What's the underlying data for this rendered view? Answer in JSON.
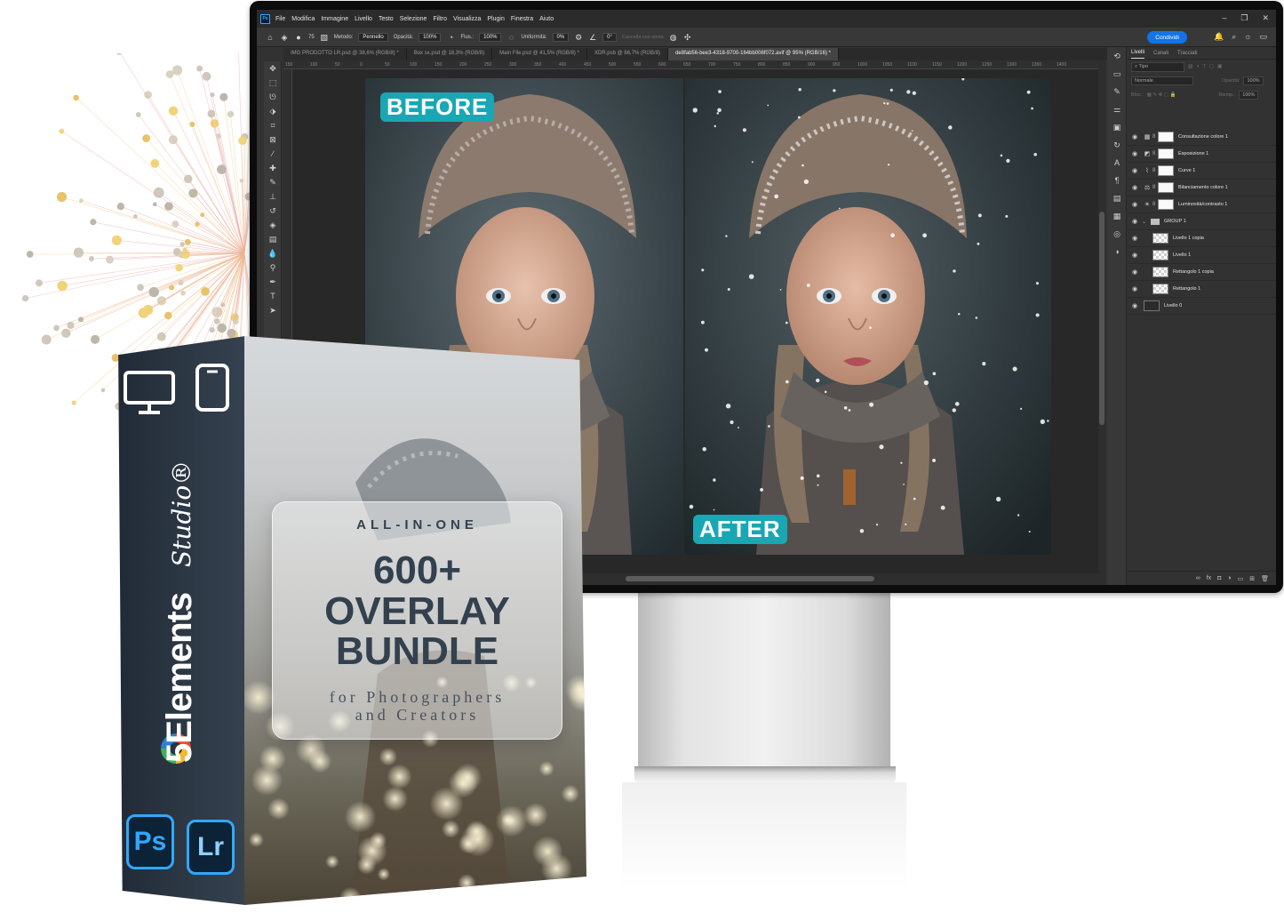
{
  "photoshop": {
    "app_icon": "Ps",
    "menu": [
      "File",
      "Modifica",
      "Immagine",
      "Livello",
      "Testo",
      "Selezione",
      "Filtro",
      "Visualizza",
      "Plugin",
      "Finestra",
      "Aiuto"
    ],
    "options": {
      "brush_size": "75",
      "mode_label": "Metodo:",
      "mode_value": "Pennello",
      "opacity_label": "Opacità:",
      "opacity_value": "100%",
      "flow_label": "Flus.:",
      "flow_value": "100%",
      "smoothing_label": "Uniformità:",
      "smoothing_value": "0%",
      "angle_value": "0°",
      "erase_history": "Cancella con storia",
      "share_button": "Condividi"
    },
    "tabs": [
      {
        "label": "IMG PRODOTTO LR.psd @ 38,6% (RGB/8) *",
        "active": false
      },
      {
        "label": "Box sx.psd @ 18,3% (RGB/8)",
        "active": false
      },
      {
        "label": "Main File.psd @ 41,5% (RGB/8) *",
        "active": false
      },
      {
        "label": "XDR.psb @ 66,7% (RGB/8)",
        "active": false
      },
      {
        "label": "de8fab56-bee3-4318-9700-164bb008f072.avif @ 95% (RGB/16) *",
        "active": true
      }
    ],
    "ruler_ticks": [
      "150",
      "100",
      "50",
      "0",
      "50",
      "100",
      "150",
      "200",
      "250",
      "300",
      "350",
      "400",
      "450",
      "500",
      "550",
      "600",
      "650",
      "700",
      "750",
      "800",
      "850",
      "900",
      "950",
      "1000",
      "1050",
      "1100",
      "1150",
      "1200",
      "1250",
      "1300",
      "1350",
      "1400"
    ],
    "canvas": {
      "before_label": "BEFORE",
      "after_label": "AFTER"
    },
    "panel": {
      "tabs": [
        "Livelli",
        "Canali",
        "Tracciati"
      ],
      "filter_placeholder": "Tipo",
      "blend_mode": "Normale",
      "opacity_label": "Opacità:",
      "opacity_value": "100%",
      "lock_label": "Bloc.:",
      "fill_label": "Riemp.:",
      "fill_value": "100%",
      "layers": [
        {
          "name": "Consultazione colore 1",
          "kind": "adjustment",
          "icon": "grid-adjust-icon"
        },
        {
          "name": "Esposizione 1",
          "kind": "adjustment",
          "icon": "exposure-icon"
        },
        {
          "name": "Curve 1",
          "kind": "adjustment",
          "icon": "curves-icon"
        },
        {
          "name": "Bilanciamento colore 1",
          "kind": "adjustment",
          "icon": "color-balance-icon"
        },
        {
          "name": "Luminosità/contrasto 1",
          "kind": "adjustment",
          "icon": "brightness-icon"
        },
        {
          "name": "GROUP 1",
          "kind": "group",
          "icon": "folder-icon"
        },
        {
          "name": "Livello 1 copia",
          "kind": "pixel",
          "icon": "transparent-thumb"
        },
        {
          "name": "Livello 1",
          "kind": "pixel",
          "icon": "transparent-thumb"
        },
        {
          "name": "Rettangolo 1 copia",
          "kind": "shape",
          "icon": "transparent-thumb"
        },
        {
          "name": "Rettangolo 1",
          "kind": "shape",
          "icon": "transparent-thumb"
        },
        {
          "name": "Livello 0",
          "kind": "pixel-photo",
          "icon": "photo-thumb"
        }
      ]
    }
  },
  "product_box": {
    "headline_top": "ALL-IN-ONE",
    "headline_1": "600+",
    "headline_2": "OVERLAY",
    "headline_3": "BUNDLE",
    "subline_1": "for Photographers",
    "subline_2": "and Creators",
    "brand": "5Elements",
    "brand_script": "Studio®",
    "apps": [
      "Ps",
      "Lr"
    ]
  },
  "colors": {
    "badge_teal": "#19a7b4",
    "ps_blue": "#31a8ff",
    "share_blue": "#1473e6",
    "ps_dark": "#323232",
    "box_spine": "#2b3542",
    "box_text": "#33414f"
  }
}
